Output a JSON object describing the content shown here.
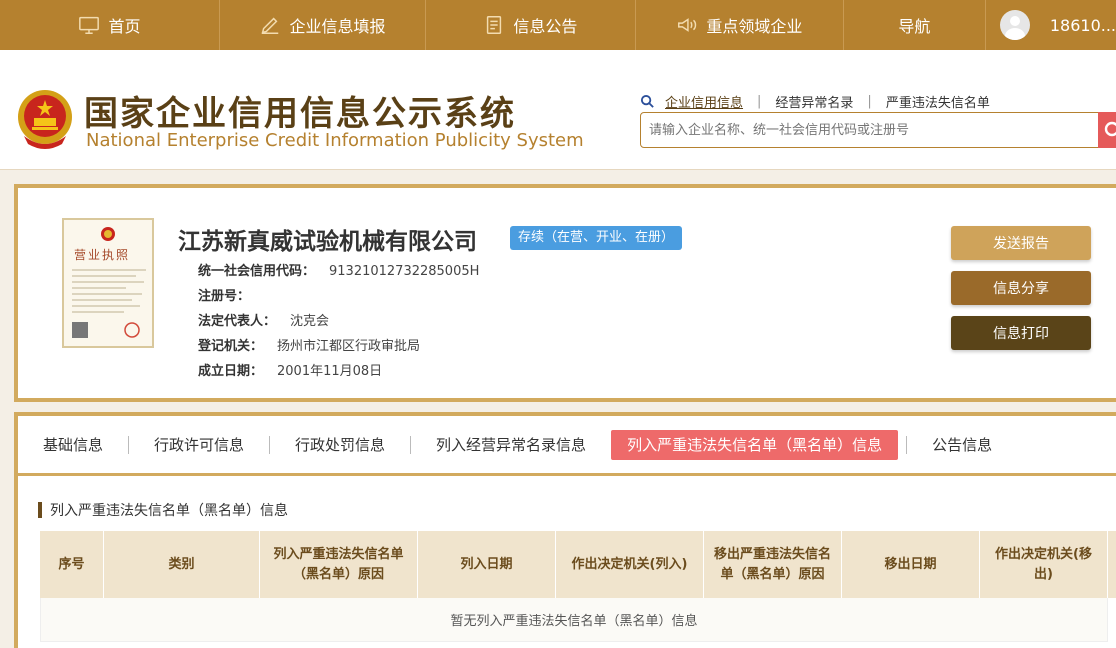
{
  "nav": {
    "items": [
      {
        "label": "首页",
        "icon": "monitor-icon"
      },
      {
        "label": "企业信息填报",
        "icon": "edit-icon"
      },
      {
        "label": "信息公告",
        "icon": "document-icon"
      },
      {
        "label": "重点领域企业",
        "icon": "megaphone-icon"
      },
      {
        "label": "导航",
        "icon": ""
      }
    ],
    "user": "18610..."
  },
  "header": {
    "title": "国家企业信用信息公示系统",
    "subtitle": "National Enterprise Credit Information Publicity System",
    "search_links": [
      "企业信用信息",
      "经营异常名录",
      "严重违法失信名单"
    ],
    "search_placeholder": "请输入企业名称、统一社会信用代码或注册号"
  },
  "license": {
    "title": "营业执照"
  },
  "company": {
    "name": "江苏新真威试验机械有限公司",
    "status": "存续（在营、开业、在册）",
    "fields": [
      {
        "label": "统一社会信用代码：",
        "value": "91321012732285005H"
      },
      {
        "label": "注册号：",
        "value": ""
      },
      {
        "label": "法定代表人：",
        "value": "沈克会"
      },
      {
        "label": "登记机关：",
        "value": "扬州市江都区行政审批局"
      },
      {
        "label": "成立日期：",
        "value": "2001年11月08日"
      }
    ]
  },
  "actions": [
    "发送报告",
    "信息分享",
    "信息打印"
  ],
  "colors": {
    "brand": "#b5812f",
    "accent_red": "#ee6a6a",
    "status_blue": "#4a9de0"
  },
  "tabs": [
    "基础信息",
    "行政许可信息",
    "行政处罚信息",
    "列入经营异常名录信息",
    "列入严重违法失信名单（黑名单）信息",
    "公告信息"
  ],
  "section": {
    "title": "列入严重违法失信名单（黑名单）信息",
    "columns": [
      "序号",
      "类别",
      "列入严重违法失信名单（黑名单）原因",
      "列入日期",
      "作出决定机关(列入)",
      "移出严重违法失信名单（黑名单）原因",
      "移出日期",
      "作出决定机关(移出)"
    ],
    "empty_text": "暂无列入严重违法失信名单（黑名单）信息"
  }
}
